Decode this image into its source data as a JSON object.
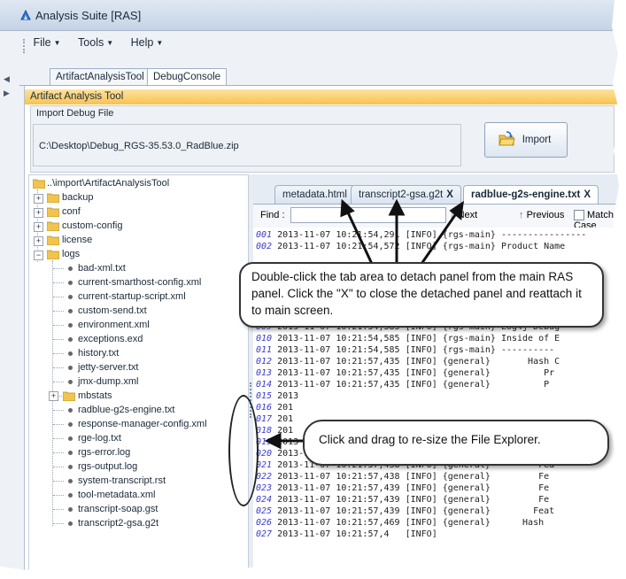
{
  "window": {
    "title": "Analysis Suite [RAS]"
  },
  "menubar": [
    {
      "label": "File"
    },
    {
      "label": "Tools"
    },
    {
      "label": "Help"
    }
  ],
  "top_tabs": [
    {
      "label": "ArtifactAnalysisTool",
      "active": false
    },
    {
      "label": "DebugConsole",
      "active": true
    }
  ],
  "panel": {
    "title": "Artifact Analysis Tool",
    "import_group_label": "Import Debug File",
    "import_path": "C:\\Desktop\\Debug_RGS-35.53.0_RadBlue.zip",
    "import_button": "Import"
  },
  "explorer": {
    "root": "..\\import\\ArtifactAnalysisTool",
    "folders_top": [
      "backup",
      "conf",
      "custom-config",
      "license",
      "logs"
    ],
    "logs_children": [
      "bad-xml.txt",
      "current-smarthost-config.xml",
      "current-startup-script.xml",
      "custom-send.txt",
      "environment.xml",
      "exceptions.exd",
      "history.txt",
      "jetty-server.txt",
      "jmx-dump.xml",
      "mbstats",
      "radblue-g2s-engine.txt",
      "response-manager-config.xml",
      "rge-log.txt",
      "rgs-error.log",
      "rgs-output.log",
      "system-transcript.rst",
      "tool-metadata.xml",
      "transcript-soap.gst",
      "transcript2-gsa.g2t"
    ]
  },
  "file_tabs": [
    {
      "label": "metadata.html",
      "close": "",
      "active": false
    },
    {
      "label": "transcript2-gsa.g2t",
      "close": "X",
      "active": false
    },
    {
      "label": "radblue-g2s-engine.txt",
      "close": "X",
      "active": true
    }
  ],
  "findbar": {
    "label": "Find :",
    "next": "Next",
    "previous": "Previous",
    "match_case": "Match Case"
  },
  "log_lines": [
    {
      "n": "001",
      "t": "2013-11-07 10:21:54,291 [INFO] {rgs-main} ----------------"
    },
    {
      "n": "002",
      "t": "2013-11-07 10:21:54,572 [INFO] {rgs-main} Product Name"
    },
    {
      "n": "",
      "t": ""
    },
    {
      "n": "",
      "t": ""
    },
    {
      "n": "",
      "t": ""
    },
    {
      "n": "",
      "t": ""
    },
    {
      "n": "",
      "t": ""
    },
    {
      "n": "008",
      "t": "2013-11-07 10:21:54,584 [INFO] {rgs-main} Log4j Config"
    },
    {
      "n": "009",
      "t": "2013-11-07 10:21:54,585 [INFO] {rgs-main} Log4j Debug"
    },
    {
      "n": "010",
      "t": "2013-11-07 10:21:54,585 [INFO] {rgs-main} Inside of E"
    },
    {
      "n": "011",
      "t": "2013-11-07 10:21:54,585 [INFO] {rgs-main} ----------"
    },
    {
      "n": "012",
      "t": "2013-11-07 10:21:57,435 [INFO] {general}       Hash C"
    },
    {
      "n": "013",
      "t": "2013-11-07 10:21:57,435 [INFO] {general}          Pr"
    },
    {
      "n": "014",
      "t": "2013-11-07 10:21:57,435 [INFO] {general}          P"
    },
    {
      "n": "015",
      "t": "2013"
    },
    {
      "n": "016",
      "t": "201"
    },
    {
      "n": "017",
      "t": "201"
    },
    {
      "n": "018",
      "t": "201"
    },
    {
      "n": "019",
      "t": "2013-11-07 10:21:57,437 [INFO] {general}        MA"
    },
    {
      "n": "020",
      "t": "2013-11-07 10:21:57,437 [INFO] {general}        Prod"
    },
    {
      "n": "021",
      "t": "2013-11-07 10:21:57,438 [INFO] {general}         Fea"
    },
    {
      "n": "022",
      "t": "2013-11-07 10:21:57,438 [INFO] {general}         Fe"
    },
    {
      "n": "023",
      "t": "2013-11-07 10:21:57,439 [INFO] {general}         Fe"
    },
    {
      "n": "024",
      "t": "2013-11-07 10:21:57,439 [INFO] {general}         Fe"
    },
    {
      "n": "025",
      "t": "2013-11-07 10:21:57,439 [INFO] {general}        Feat"
    },
    {
      "n": "026",
      "t": "2013-11-07 10:21:57,469 [INFO] {general}      Hash"
    },
    {
      "n": "027",
      "t": "2013-11-07 10:21:57,4   [INFO]"
    }
  ],
  "callouts": {
    "tabs": "Double-click the tab area to detach panel from the main RAS panel. Click the \"X\" to close the detached panel and reattach it to main screen.",
    "resize": "Click and drag to re-size the File Explorer."
  },
  "colors": {
    "panel_header": "#f9c24e",
    "line_numbers": "#3a3ad0",
    "green_arrow": "#2e9e2e"
  }
}
